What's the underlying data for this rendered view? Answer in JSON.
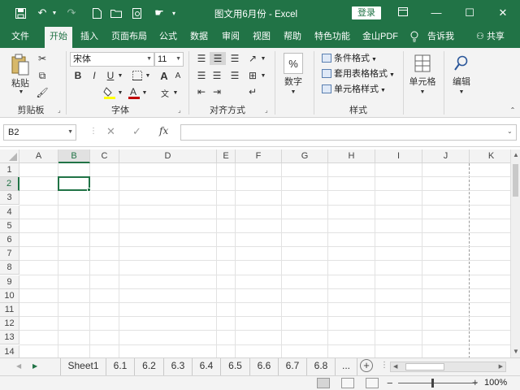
{
  "window": {
    "title": "图文用6月份  -  Excel",
    "login_label": "登录",
    "accent": "#217346"
  },
  "quick_access": {
    "save": "save-icon",
    "undo": "undo-icon",
    "redo": "redo-icon",
    "new": "new-file-icon",
    "open": "open-folder-icon",
    "print_preview": "print-preview-icon",
    "touch": "touch-mode-icon",
    "customize": "customize-icon"
  },
  "tabs": [
    "文件",
    "开始",
    "插入",
    "页面布局",
    "公式",
    "数据",
    "审阅",
    "视图",
    "帮助",
    "特色功能",
    "金山PDF"
  ],
  "active_tab": "开始",
  "tell_me": "告诉我",
  "share": "共享",
  "ribbon": {
    "clipboard": {
      "paste": "粘贴",
      "label": "剪贴板"
    },
    "font": {
      "name": "宋体",
      "size": "11",
      "label": "字体",
      "font_color": "#c00000",
      "fill_color": "#ffff00"
    },
    "alignment": {
      "label": "对齐方式"
    },
    "number": {
      "button": "数字"
    },
    "styles": {
      "conditional": "条件格式",
      "table": "套用表格格式",
      "cell": "单元格样式",
      "label": "样式"
    },
    "cells": {
      "button": "单元格"
    },
    "editing": {
      "button": "编辑"
    }
  },
  "formula_bar": {
    "name_box": "B2",
    "fx": "fx",
    "content": ""
  },
  "grid": {
    "columns": [
      "A",
      "B",
      "C",
      "D",
      "E",
      "F",
      "G",
      "H",
      "I",
      "J",
      "K"
    ],
    "rows": [
      "1",
      "2",
      "3",
      "4",
      "5",
      "6",
      "7",
      "8",
      "9",
      "10",
      "11",
      "12",
      "13",
      "14"
    ],
    "selected_cell": "B2"
  },
  "sheets": [
    "Sheet1",
    "6.1",
    "6.2",
    "6.3",
    "6.4",
    "6.5",
    "6.6",
    "6.7",
    "6.8",
    "..."
  ],
  "status": {
    "zoom": "100%"
  }
}
